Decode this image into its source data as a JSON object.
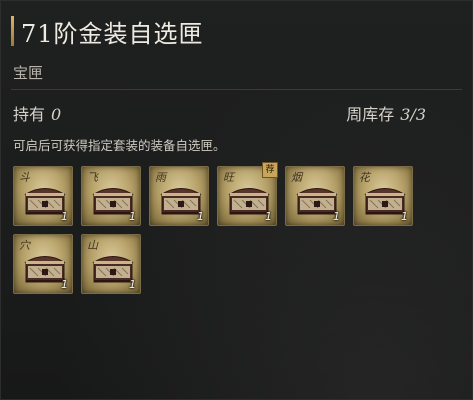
{
  "header": {
    "title": "71阶金装自选匣",
    "subtitle": "宝匣"
  },
  "info": {
    "held_label": "持有",
    "held_value": "0",
    "stock_label": "周库存",
    "stock_value": "3/3",
    "description": "可启后可获得指定套装的装备自选匣。"
  },
  "items": [
    {
      "mark": "斗",
      "qty": "1",
      "badge": ""
    },
    {
      "mark": "飞",
      "qty": "1",
      "badge": ""
    },
    {
      "mark": "雨",
      "qty": "1",
      "badge": ""
    },
    {
      "mark": "旺",
      "qty": "1",
      "badge": "荐"
    },
    {
      "mark": "烟",
      "qty": "1",
      "badge": ""
    },
    {
      "mark": "花",
      "qty": "1",
      "badge": ""
    },
    {
      "mark": "穴",
      "qty": "1",
      "badge": ""
    },
    {
      "mark": "山",
      "qty": "1",
      "badge": ""
    }
  ],
  "colors": {
    "accent_gold": "#d9b46a",
    "slot_border": "#7b6c45",
    "background": "#1c1d1d"
  },
  "icons": {
    "item_icon": "treasure-chest-icon",
    "badge_icon": "recommend-badge"
  }
}
